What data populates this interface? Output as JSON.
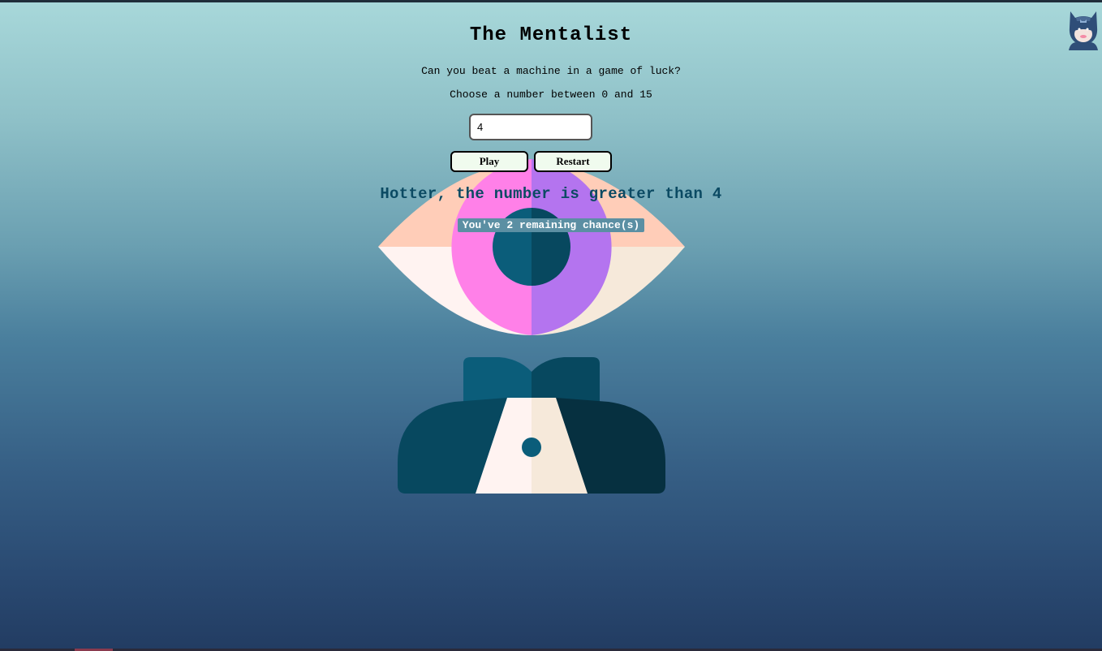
{
  "game": {
    "title": "The Mentalist",
    "subtitle": "Can you beat a machine in a game of luck?",
    "instruction": "Choose a number between 0 and 15",
    "guess_value": "4",
    "play_label": "Play",
    "restart_label": "Restart",
    "feedback": "Hotter, the number is greater than 4",
    "chances": "You've 2 remaining chance(s)"
  },
  "icons": {
    "avatar": "masked-hero-avatar-icon",
    "mascot": "eye-mentalist-illustration"
  },
  "colors": {
    "feedback_text": "#0b4a63",
    "chances_badge": "#5b8fa3",
    "button_bg": "#f0fbee"
  }
}
